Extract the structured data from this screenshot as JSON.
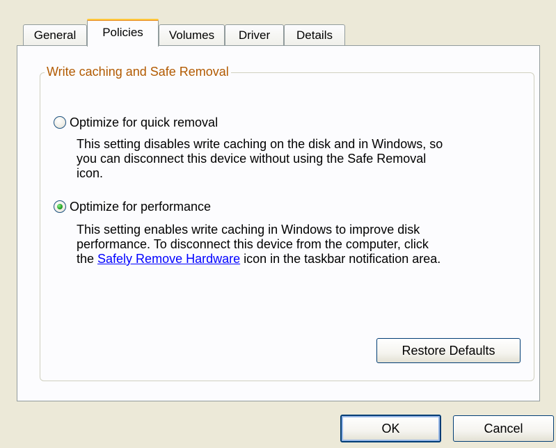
{
  "tabs": [
    {
      "label": "General",
      "active": false
    },
    {
      "label": "Policies",
      "active": true
    },
    {
      "label": "Volumes",
      "active": false
    },
    {
      "label": "Driver",
      "active": false
    },
    {
      "label": "Details",
      "active": false
    }
  ],
  "group": {
    "title": "Write caching and Safe Removal",
    "title_color": "#b25a00"
  },
  "options": {
    "quick_removal": {
      "label": "Optimize for quick removal",
      "selected": false,
      "desc_lines": [
        "This setting disables write caching on the disk and in Windows, so",
        "you can disconnect this device without using the Safe Removal",
        "icon."
      ]
    },
    "performance": {
      "label": "Optimize for performance",
      "selected": true,
      "desc_lines": [
        "This setting enables write caching in Windows to improve disk",
        "performance. To disconnect this device from the computer, click"
      ],
      "desc_prefix": "the ",
      "link_text": "Safely Remove Hardware",
      "desc_suffix": " icon in the taskbar notification area."
    }
  },
  "buttons": {
    "restore_defaults": "Restore Defaults",
    "ok": "OK",
    "cancel": "Cancel"
  },
  "colors": {
    "dialog_bg": "#ece9d8",
    "panel_bg": "#fcfcfe",
    "active_tab_accent": "#e68b2c",
    "link": "#0000ff",
    "button_border": "#003c74"
  }
}
